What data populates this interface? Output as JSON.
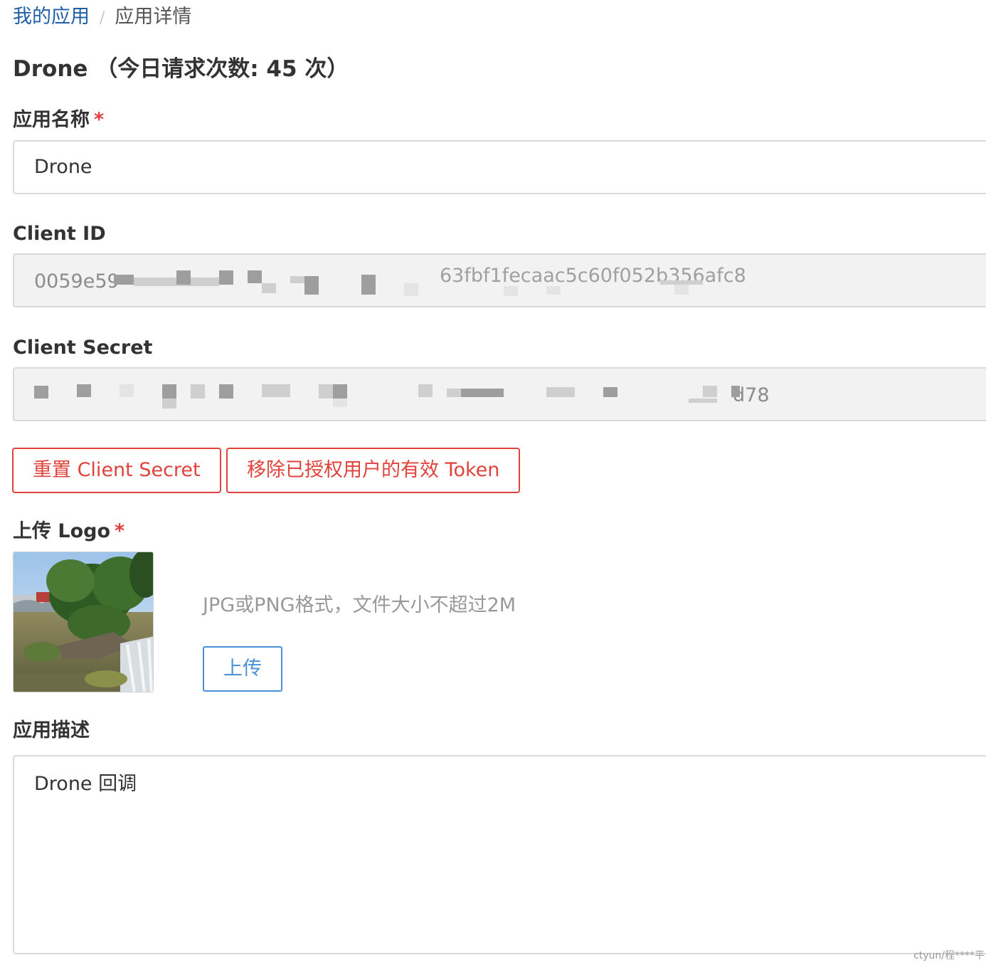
{
  "breadcrumb": {
    "link": "我的应用",
    "separator": "/",
    "current": "应用详情"
  },
  "page_title": "Drone （今日请求次数: 45 次）",
  "form": {
    "app_name": {
      "label": "应用名称",
      "required_mark": "*",
      "value": "Drone"
    },
    "client_id": {
      "label": "Client ID",
      "visible_start": "0059e59",
      "visible_end": "63fbf1fecaac5c60f052b356afc8"
    },
    "client_secret": {
      "label": "Client Secret",
      "visible_end": "d78"
    },
    "buttons": {
      "reset_secret": "重置 Client Secret",
      "revoke_tokens": "移除已授权用户的有效 Token"
    },
    "logo": {
      "label": "上传 Logo",
      "required_mark": "*",
      "hint": "JPG或PNG格式，文件大小不超过2M",
      "upload_label": "上传"
    },
    "description": {
      "label": "应用描述",
      "value": "Drone 回调"
    }
  },
  "watermark": "ctyun/程****平",
  "colors": {
    "link": "#1f5fa8",
    "danger": "#e0433b",
    "primary": "#4a90d9",
    "required": "#e23c3c"
  }
}
